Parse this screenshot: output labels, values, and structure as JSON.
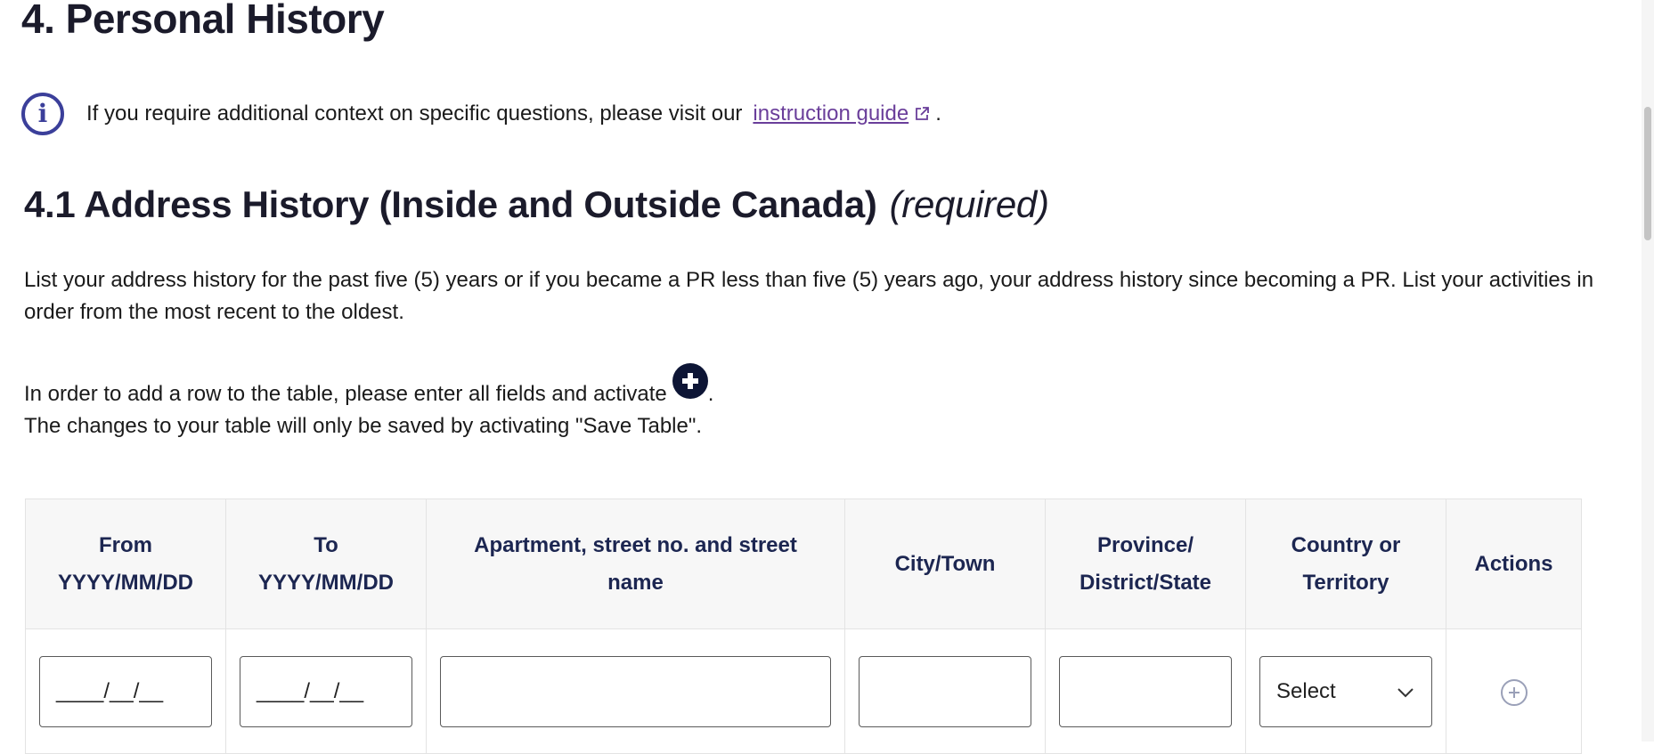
{
  "page": {
    "section_title": "4. Personal History",
    "info": {
      "icon": "info-icon",
      "text": "If you require additional context on specific questions, please visit our",
      "link_text": "instruction guide",
      "link_icon": "external-link-icon",
      "suffix": "."
    },
    "subsection": {
      "title": "4.1 Address History (Inside and Outside Canada)",
      "required": "(required)"
    },
    "description": "List your address history for the past five (5) years or if you became a PR less than five (5) years ago, your address history since becoming a PR. List your activities in order from the most recent to the oldest.",
    "instructions": {
      "line1_prefix": "In order to add a row to the table, please enter all fields and activate",
      "line1_suffix": ".",
      "line2": "The changes to your table will only be saved by activating \"Save Table\"."
    }
  },
  "table": {
    "headers": {
      "from": "From",
      "from_format": "YYYY/MM/DD",
      "to": "To",
      "to_format": "YYYY/MM/DD",
      "street": "Apartment, street no. and street name",
      "city": "City/Town",
      "province_line1": "Province/",
      "province_line2": "District/State",
      "country_line1": "Country or",
      "country_line2": "Territory",
      "actions": "Actions"
    },
    "row": {
      "from_placeholder": "____/__/__",
      "to_placeholder": "____/__/__",
      "street_value": "",
      "city_value": "",
      "province_value": "",
      "country_selected": "Select"
    }
  },
  "colors": {
    "heading": "#1b1b2b",
    "info_icon": "#3b3f9a",
    "link": "#6a3e9a",
    "table_header_text": "#1c2651",
    "plus_icon": "#0d1535"
  }
}
